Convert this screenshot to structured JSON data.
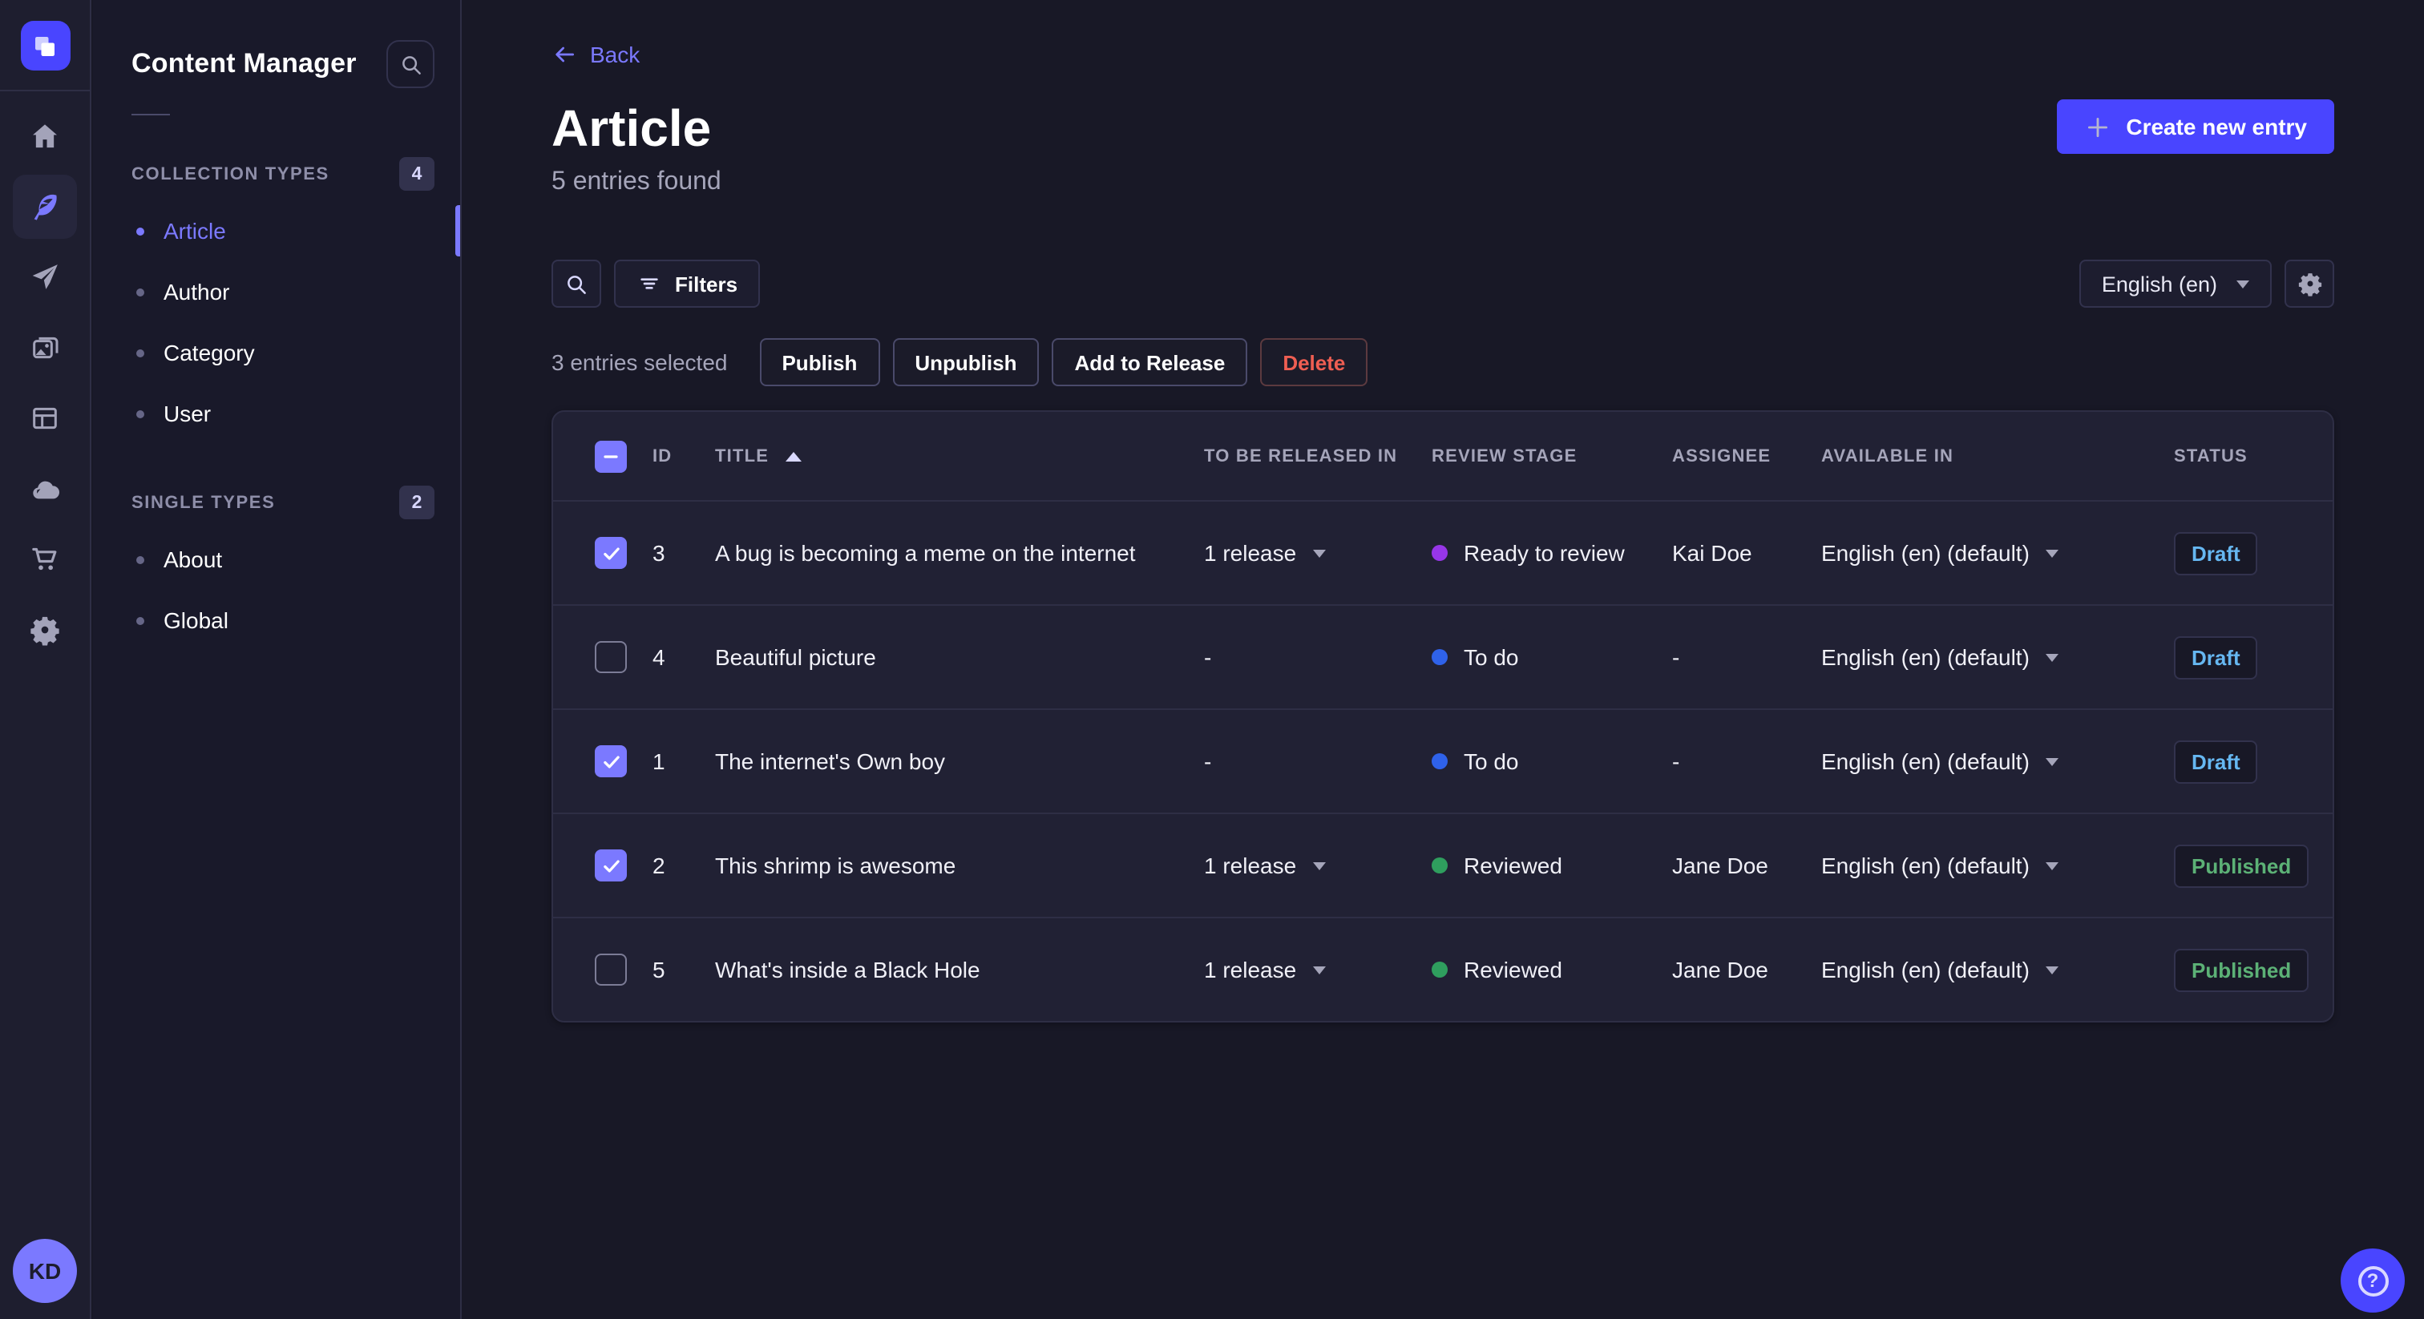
{
  "colors": {
    "accent": "#4945ff",
    "accent_light": "#7b79ff",
    "status_draft": "#66b7f1",
    "status_published": "#5cb176",
    "stage_todo": "#2f62ea",
    "stage_ready_to_review": "#9736e8",
    "stage_reviewed": "#2f9e5e",
    "danger": "#ee5e52"
  },
  "rail": {
    "avatar_initials": "KD"
  },
  "subnav": {
    "title": "Content Manager",
    "sections": [
      {
        "label": "COLLECTION TYPES",
        "count": "4",
        "items": [
          {
            "label": "Article",
            "active": true
          },
          {
            "label": "Author",
            "active": false
          },
          {
            "label": "Category",
            "active": false
          },
          {
            "label": "User",
            "active": false
          }
        ]
      },
      {
        "label": "SINGLE TYPES",
        "count": "2",
        "items": [
          {
            "label": "About",
            "active": false
          },
          {
            "label": "Global",
            "active": false
          }
        ]
      }
    ]
  },
  "header": {
    "back_label": "Back",
    "title": "Article",
    "subtitle": "5 entries found",
    "create_button_label": "Create new entry"
  },
  "toolbar": {
    "filters_label": "Filters",
    "locale_value": "English (en)"
  },
  "selection": {
    "summary": "3 entries selected",
    "publish_label": "Publish",
    "unpublish_label": "Unpublish",
    "add_to_release_label": "Add to Release",
    "delete_label": "Delete"
  },
  "table": {
    "headers": {
      "id": "ID",
      "title": "TITLE",
      "released": "TO BE RELEASED IN",
      "review": "REVIEW STAGE",
      "assignee": "ASSIGNEE",
      "available": "AVAILABLE IN",
      "status": "STATUS"
    },
    "sort": {
      "column": "TITLE",
      "direction": "asc"
    },
    "rows": [
      {
        "checked": true,
        "id": "3",
        "title": "A bug is becoming a meme on the internet",
        "released": "1 release",
        "review_stage": "Ready to review",
        "review_color": "#9736e8",
        "assignee": "Kai Doe",
        "available": "English (en) (default)",
        "status": "Draft",
        "status_color": "#66b7f1"
      },
      {
        "checked": false,
        "id": "4",
        "title": "Beautiful picture",
        "released": "-",
        "review_stage": "To do",
        "review_color": "#2f62ea",
        "assignee": "-",
        "available": "English (en) (default)",
        "status": "Draft",
        "status_color": "#66b7f1"
      },
      {
        "checked": true,
        "id": "1",
        "title": "The internet's Own boy",
        "released": "-",
        "review_stage": "To do",
        "review_color": "#2f62ea",
        "assignee": "-",
        "available": "English (en) (default)",
        "status": "Draft",
        "status_color": "#66b7f1"
      },
      {
        "checked": true,
        "id": "2",
        "title": "This shrimp is awesome",
        "released": "1 release",
        "review_stage": "Reviewed",
        "review_color": "#2f9e5e",
        "assignee": "Jane Doe",
        "available": "English (en) (default)",
        "status": "Published",
        "status_color": "#5cb176"
      },
      {
        "checked": false,
        "id": "5",
        "title": "What's inside a Black Hole",
        "released": "1 release",
        "review_stage": "Reviewed",
        "review_color": "#2f9e5e",
        "assignee": "Jane Doe",
        "available": "English (en) (default)",
        "status": "Published",
        "status_color": "#5cb176"
      }
    ]
  },
  "help": {
    "glyph": "?"
  }
}
